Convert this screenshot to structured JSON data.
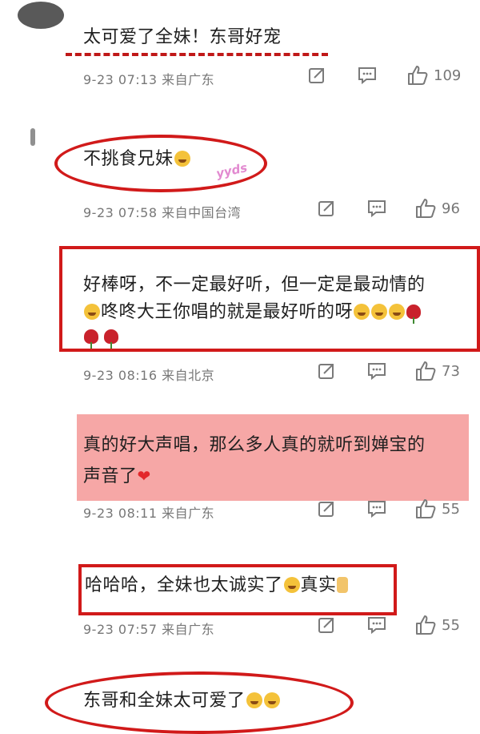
{
  "comments": [
    {
      "text": "太可爱了全妹！东哥好宠",
      "meta": "9-23 07:13 来自广东",
      "likes": "109"
    },
    {
      "text": "不挑食兄妹",
      "meta": "9-23 07:58 来自中国台湾",
      "likes": "96",
      "sticker": "yyds"
    },
    {
      "text_line1": "好棒呀，不一定最好听，但一定是最动情的",
      "text_line2": "咚咚大王你唱的就是最好听的呀",
      "meta": "9-23 08:16 来自北京",
      "likes": "73"
    },
    {
      "text_line1": "真的好大声唱，那么多人真的就听到婵宝的",
      "text_line2": "声音了",
      "meta": "9-23 08:11 来自广东",
      "likes": "55"
    },
    {
      "text": "哈哈哈，全妹也太诚实了",
      "text_tail": "真实",
      "meta": "9-23 07:57 来自广东",
      "likes": "55"
    },
    {
      "text": "东哥和全妹太可爱了"
    }
  ],
  "icons": [
    "share-icon",
    "comment-icon",
    "like-icon"
  ],
  "colors": {
    "highlight": "#d11a1a",
    "pink_bg": "#f6a7a6",
    "meta": "#777777"
  }
}
